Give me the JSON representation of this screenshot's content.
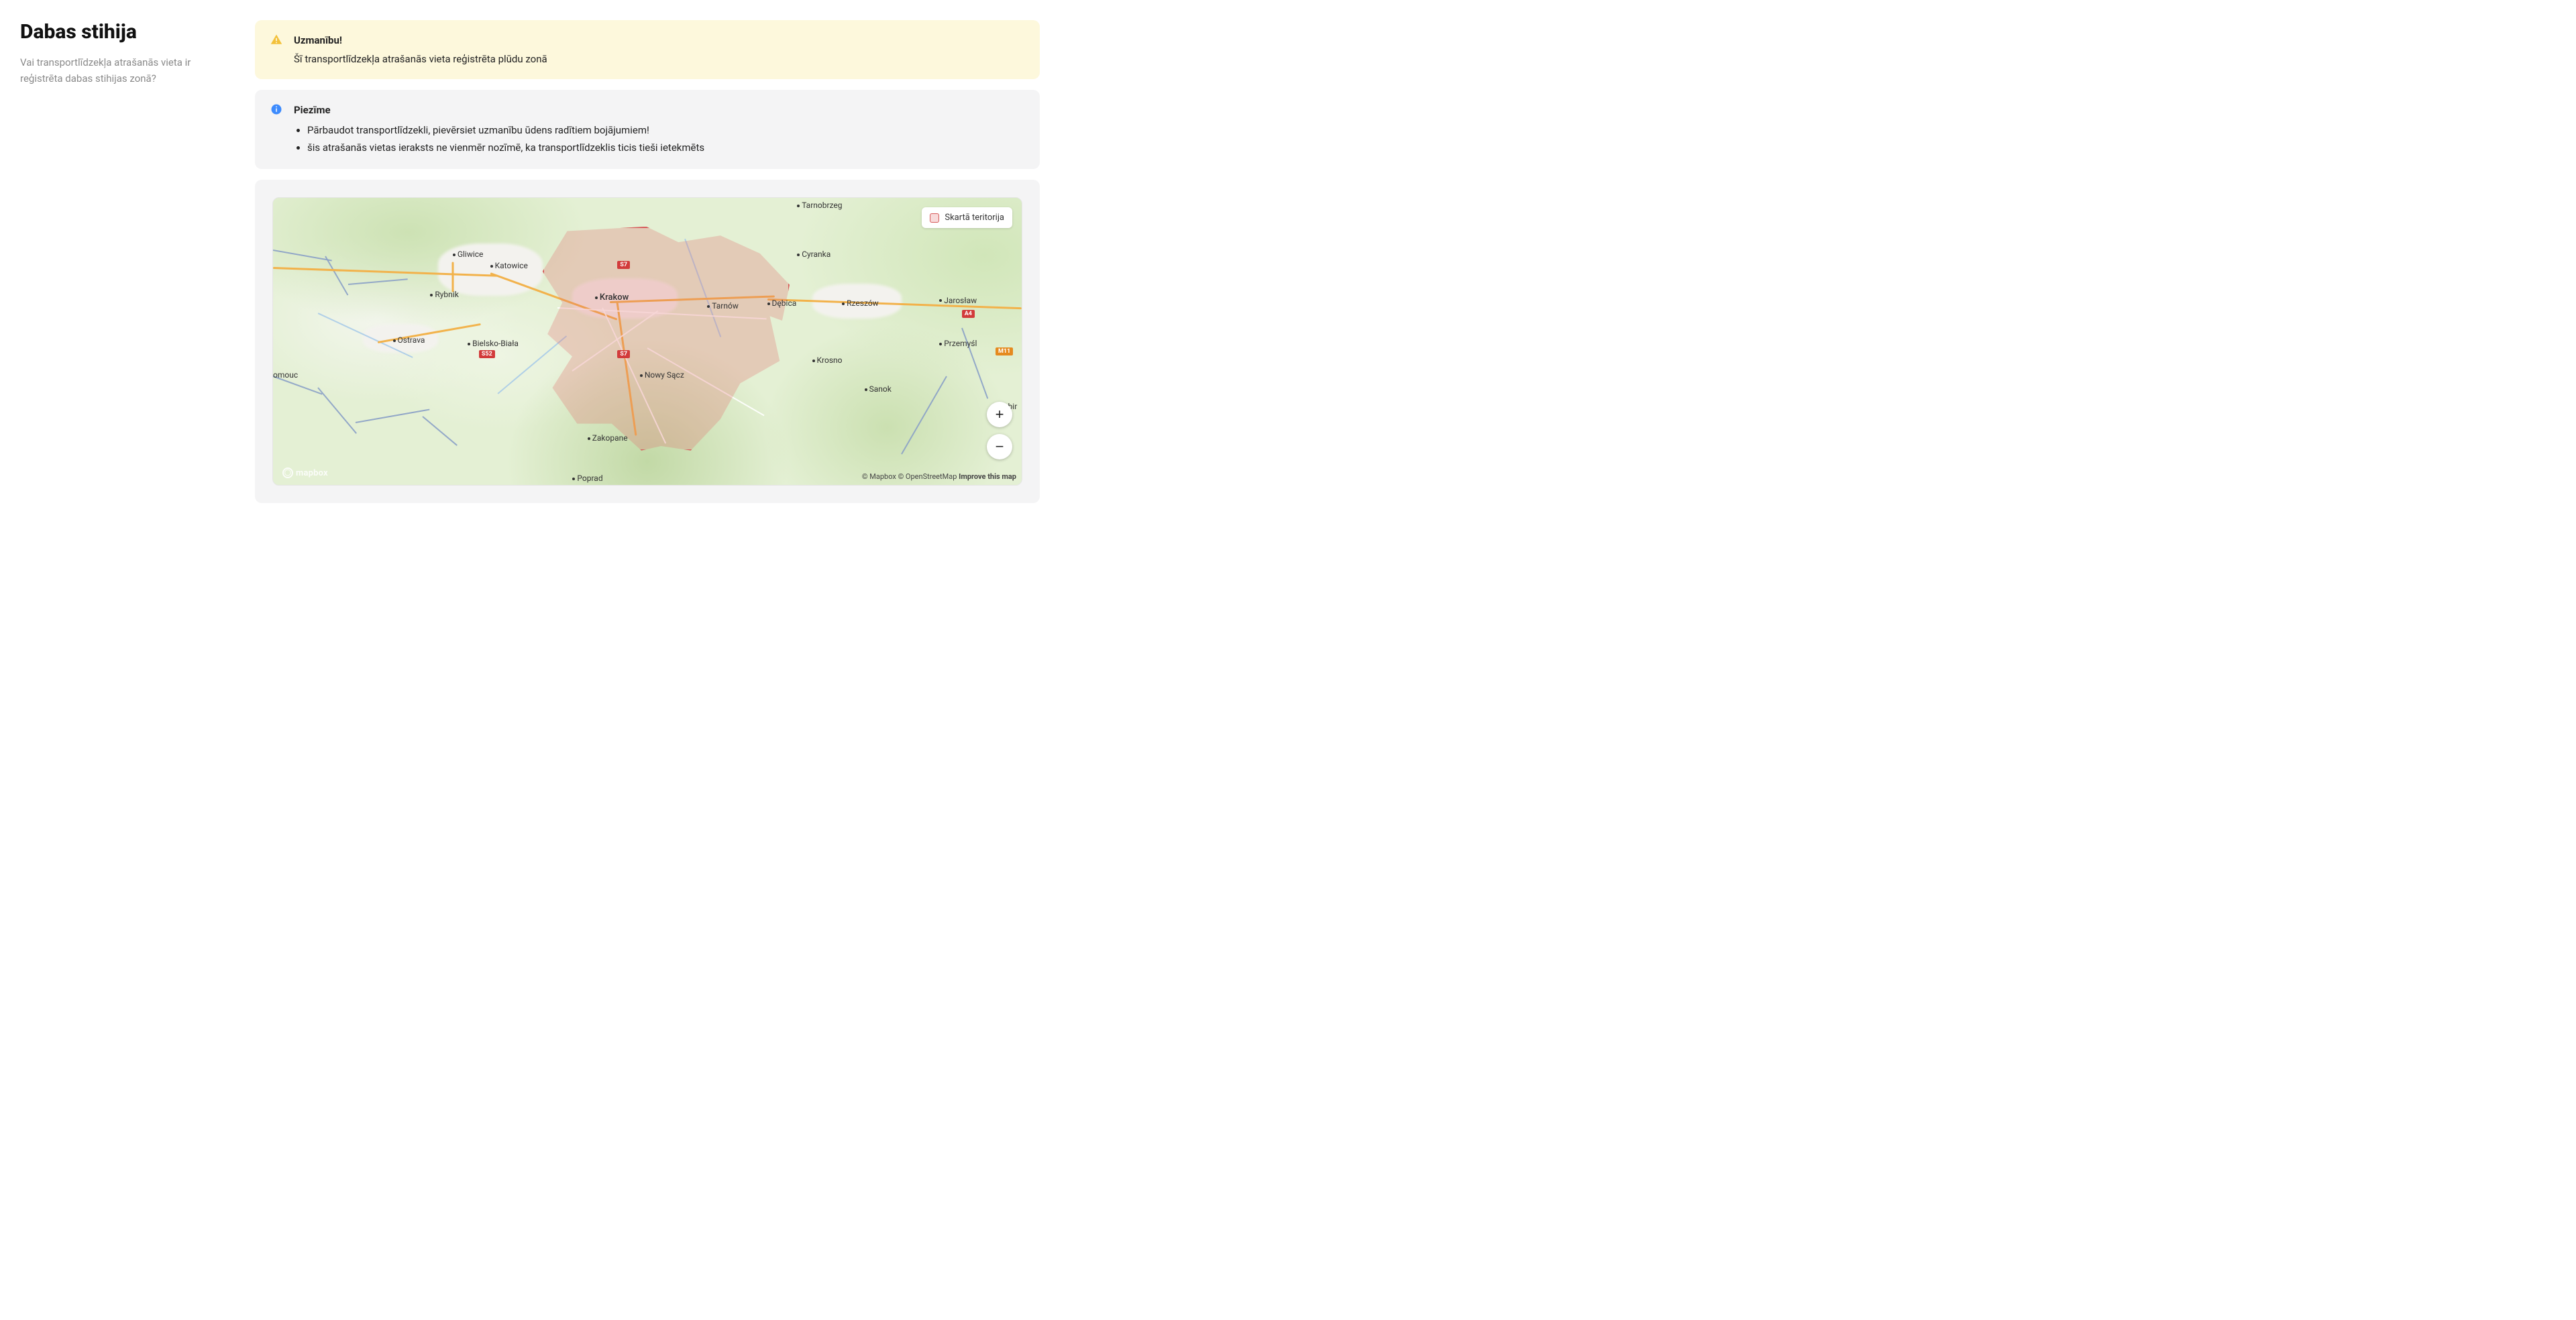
{
  "sidebar": {
    "title": "Dabas stihija",
    "subtitle": "Vai transportlīdzekļa atrašanās vieta ir reģistrēta dabas stihijas zonā?"
  },
  "alerts": {
    "warning": {
      "title": "Uzmanību!",
      "text": "Šī transportlīdzekļa atrašanās vieta reģistrēta plūdu zonā"
    },
    "info": {
      "title": "Piezīme",
      "items": [
        "Pārbaudot transportlīdzekli, pievērsiet uzmanību ūdens radītiem bojājumiem!",
        "šis atrašanās vietas ieraksts ne vienmēr nozīmē, ka transportlīdzeklis ticis tieši ietekmēts"
      ]
    }
  },
  "map": {
    "legend_label": "Skartā teritorija",
    "zoom_in": "+",
    "zoom_out": "−",
    "logo_text": "mapbox",
    "attribution": {
      "mapbox": "© Mapbox",
      "osm": "© OpenStreetMap",
      "improve": "Improve this map"
    },
    "shields": {
      "s7a": "S7",
      "s7b": "S7",
      "s52": "S52",
      "a4": "A4",
      "m11": "M11"
    },
    "cities": {
      "gliwice": "Gliwice",
      "katowice": "Katowice",
      "rybnik": "Rybnik",
      "ostrava": "Ostrava",
      "bielsko": "Bielsko-Biała",
      "olomouc": "omouc",
      "krakow": "Krakow",
      "tarnow": "Tarnów",
      "nowysacz": "Nowy Sącz",
      "zakopane": "Zakopane",
      "poprad": "Poprad",
      "tarnobrzeg": "Tarnobrzeg",
      "cyranka": "Cyranka",
      "debica": "Dębica",
      "rzeszow": "Rzeszów",
      "jaroslaw": "Jarosław",
      "przemysl": "Przemyśl",
      "krosno": "Krosno",
      "sanok": "Sanok",
      "sambir": "Sambir"
    }
  }
}
